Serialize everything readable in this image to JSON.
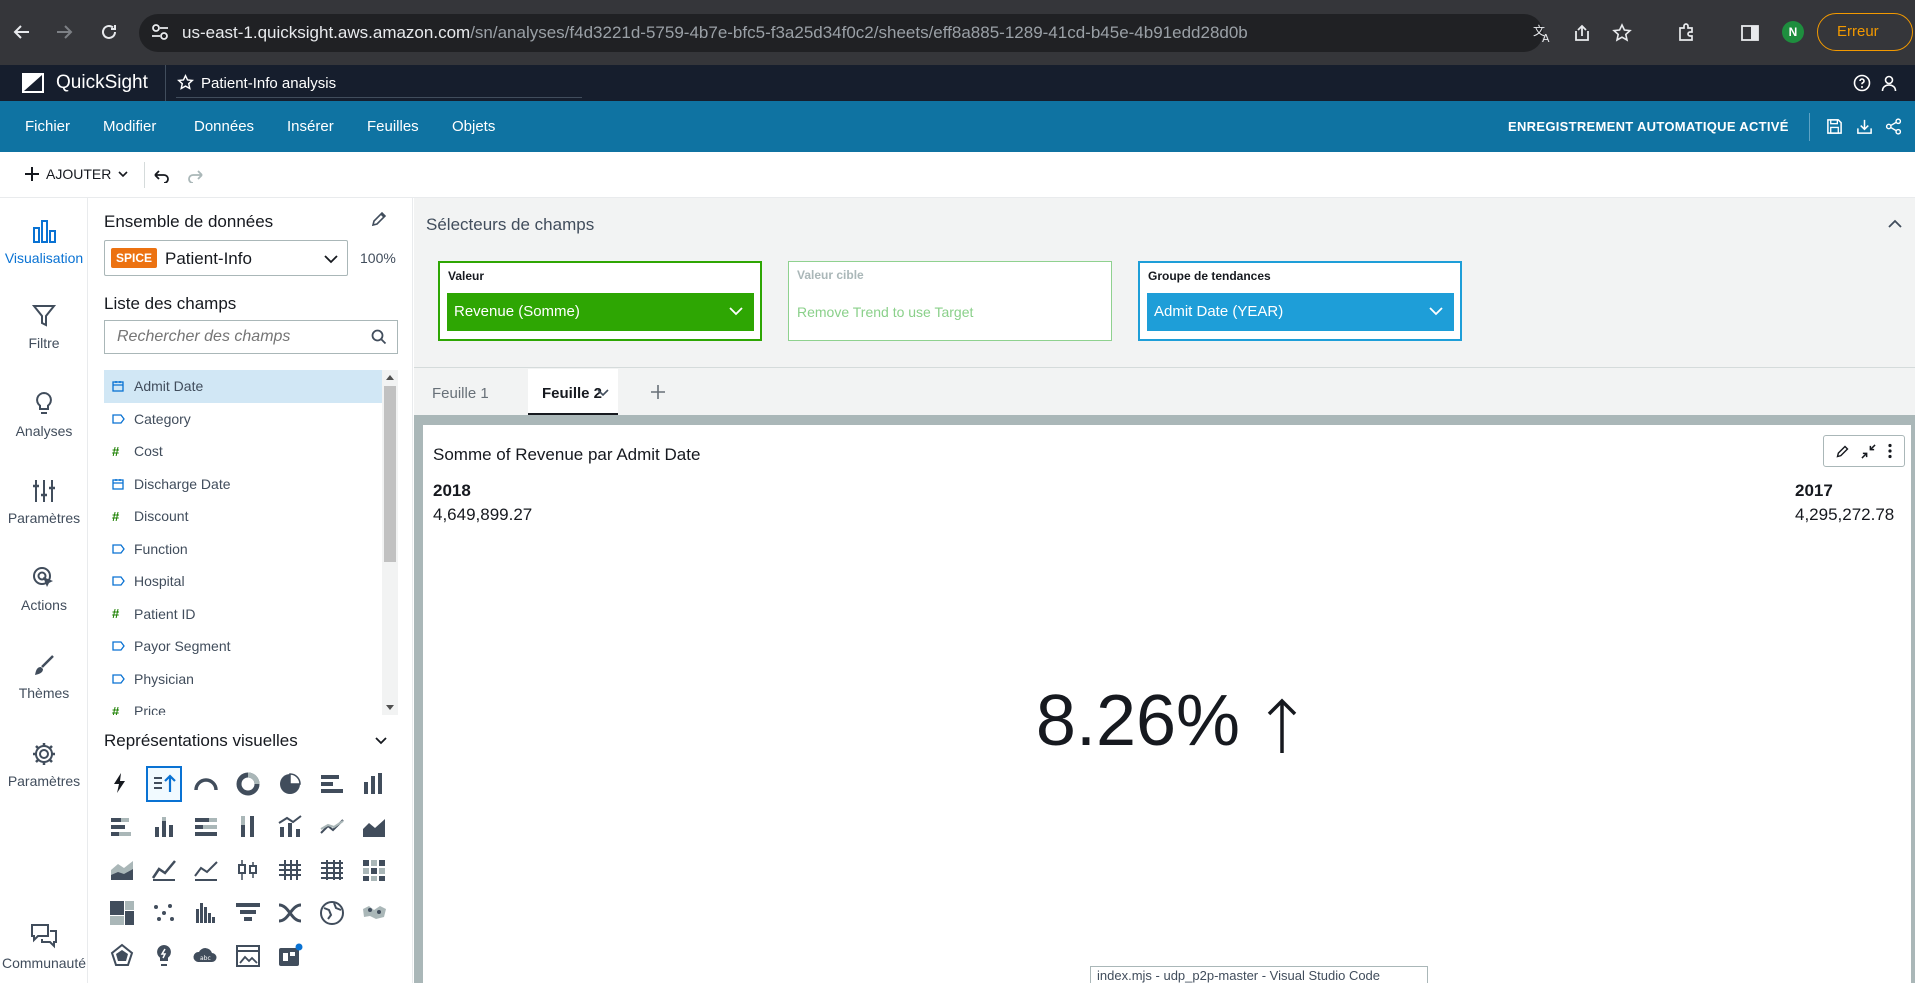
{
  "browser": {
    "url_host": "us-east-1.quicksight.aws.amazon.com",
    "url_path": "/sn/analyses/f4d3221d-5759-4b7e-bfc5-f3a25d34f0c2/sheets/eff8a885-1289-41cd-b45e-4b91edd28d0b",
    "profile_initial": "N",
    "error_label": "Erreur"
  },
  "app": {
    "brand": "QuickSight",
    "analysis_title": "Patient-Info analysis"
  },
  "menu": {
    "items": [
      "Fichier",
      "Modifier",
      "Données",
      "Insérer",
      "Feuilles",
      "Objets"
    ],
    "autosave": "ENREGISTREMENT AUTOMATIQUE ACTIVÉ"
  },
  "toolbar": {
    "add_label": "AJOUTER"
  },
  "rail": {
    "items": [
      "Visualisation",
      "Filtre",
      "Analyses",
      "Paramètres",
      "Actions",
      "Thèmes",
      "Paramètres",
      "Communauté"
    ]
  },
  "data_panel": {
    "dataset_heading": "Ensemble de données",
    "spice_badge": "SPICE",
    "dataset_name": "Patient-Info",
    "spice_percent": "100%",
    "fields_heading": "Liste des champs",
    "search_placeholder": "Rechercher des champs",
    "fields": [
      {
        "name": "Admit Date",
        "type": "date"
      },
      {
        "name": "Category",
        "type": "dim"
      },
      {
        "name": "Cost",
        "type": "meas"
      },
      {
        "name": "Discharge Date",
        "type": "date"
      },
      {
        "name": "Discount",
        "type": "meas"
      },
      {
        "name": "Function",
        "type": "dim"
      },
      {
        "name": "Hospital",
        "type": "dim"
      },
      {
        "name": "Patient ID",
        "type": "meas"
      },
      {
        "name": "Payor Segment",
        "type": "dim"
      },
      {
        "name": "Physician",
        "type": "dim"
      },
      {
        "name": "Price",
        "type": "meas"
      }
    ],
    "visuals_heading": "Représentations visuelles"
  },
  "field_wells": {
    "title": "Sélecteurs de champs",
    "value_label": "Valeur",
    "value_field": "Revenue (Somme)",
    "target_label": "Valeur cible",
    "target_placeholder": "Remove Trend to use Target",
    "trend_label": "Groupe de tendances",
    "trend_field": "Admit Date (YEAR)",
    "colors": {
      "value": "#2ea603",
      "target": "#8fd18f",
      "trend": "#1e9ed8"
    }
  },
  "sheets": {
    "tabs": [
      "Feuille 1",
      "Feuille 2"
    ],
    "active": "Feuille 2"
  },
  "visual": {
    "title": "Somme of Revenue par Admit Date",
    "current_period": "2018",
    "current_value": "4,649,899.27",
    "prior_period": "2017",
    "prior_value": "4,295,272.78",
    "kpi_change": "8.26%",
    "kpi_direction": "up"
  },
  "taskbar_tooltip": "index.mjs - udp_p2p-master - Visual Studio Code"
}
